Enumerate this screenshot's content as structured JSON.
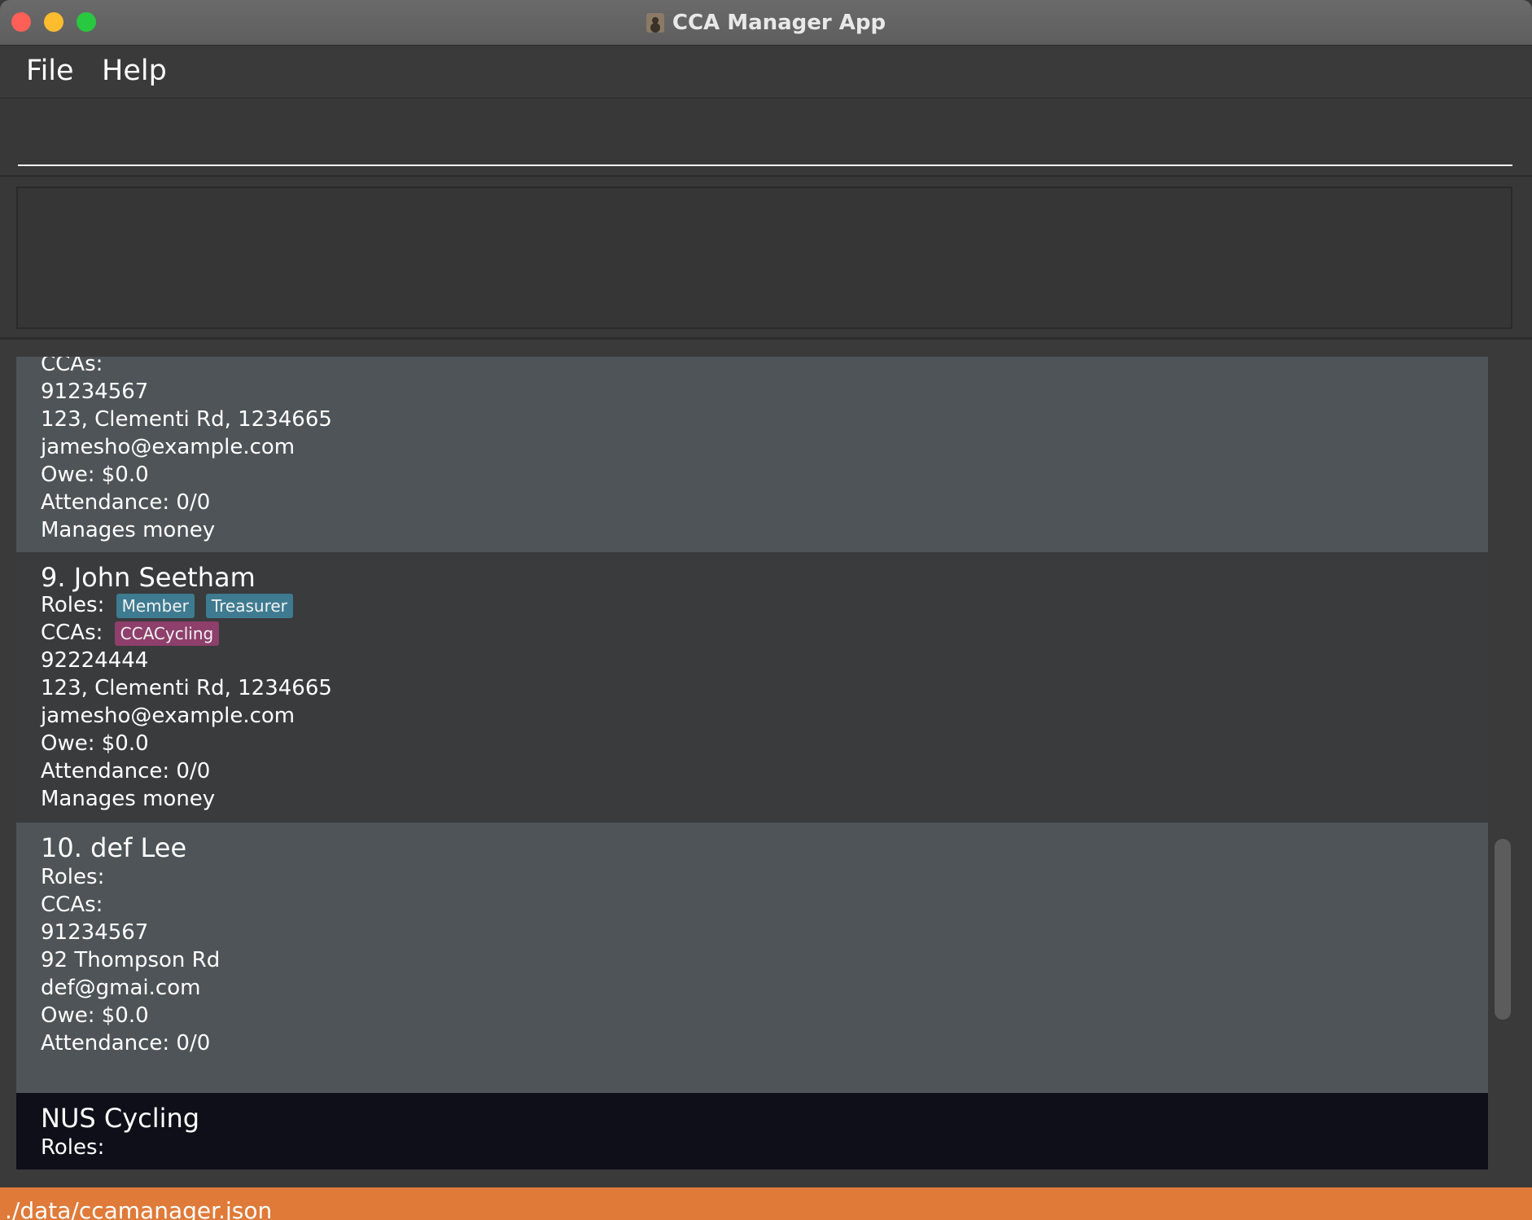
{
  "window": {
    "title": "CCA Manager App"
  },
  "menu": {
    "file": "File",
    "help": "Help"
  },
  "command": {
    "value": "",
    "placeholder": ""
  },
  "result": {
    "text": ""
  },
  "cards": [
    {
      "id": "partial-8",
      "ccas_label": "CCAs:",
      "phone": "91234567",
      "address": "123, Clementi Rd, 1234665",
      "email": "jamesho@example.com",
      "owe": "Owe: $0.0",
      "attendance": "Attendance: 0/0",
      "remark": "Manages money"
    },
    {
      "id": "9",
      "title": "9.  John Seetham",
      "roles_label": "Roles:",
      "roles": [
        "Member",
        "Treasurer"
      ],
      "ccas_label": "CCAs:",
      "ccas": [
        "CCACycling"
      ],
      "phone": "92224444",
      "address": "123, Clementi Rd, 1234665",
      "email": "jamesho@example.com",
      "owe": "Owe: $0.0",
      "attendance": "Attendance: 0/0",
      "remark": "Manages money"
    },
    {
      "id": "10",
      "title": "10.  def Lee",
      "roles_label": "Roles:",
      "ccas_label": "CCAs:",
      "phone": "91234567",
      "address": "92 Thompson Rd",
      "email": "def@gmai.com",
      "owe": "Owe: $0.0",
      "attendance": "Attendance: 0/0"
    },
    {
      "id": "cca",
      "title": "NUS Cycling",
      "roles_label": "Roles:"
    }
  ],
  "status": {
    "path": "./data/ccamanager.json"
  }
}
